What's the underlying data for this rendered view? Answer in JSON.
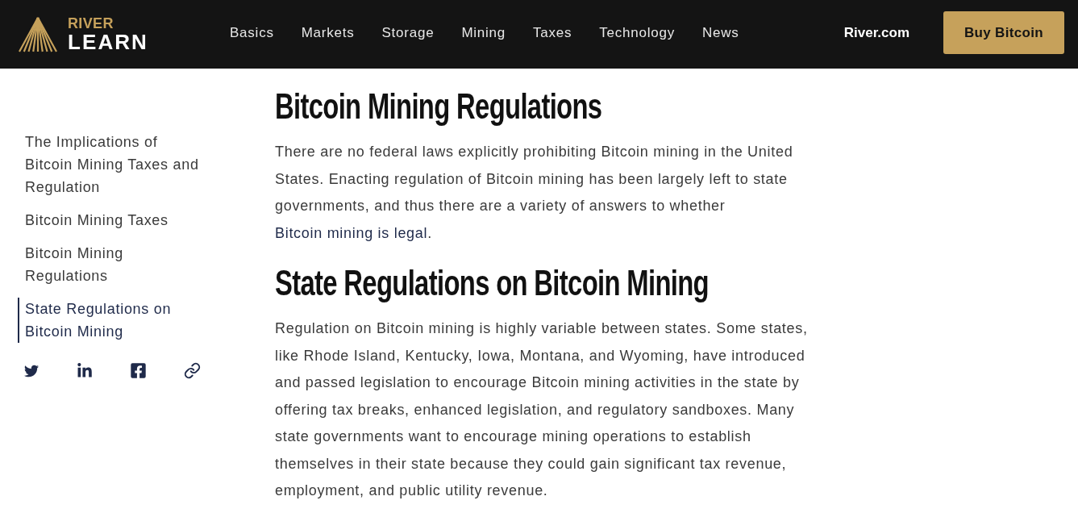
{
  "header": {
    "logo": {
      "top": "RIVER",
      "bottom": "LEARN"
    },
    "nav": [
      {
        "label": "Basics"
      },
      {
        "label": "Markets"
      },
      {
        "label": "Storage"
      },
      {
        "label": "Mining"
      },
      {
        "label": "Taxes"
      },
      {
        "label": "Technology"
      },
      {
        "label": "News"
      }
    ],
    "site_link": "River.com",
    "cta": "Buy Bitcoin"
  },
  "sidebar": {
    "toc": [
      {
        "label": "The Implications of Bitcoin Mining Taxes and Regulation",
        "selected": false
      },
      {
        "label": "Bitcoin Mining Taxes",
        "selected": false
      },
      {
        "label": "Bitcoin Mining Regulations",
        "selected": false
      },
      {
        "label": "State Regulations on Bitcoin Mining",
        "selected": true
      }
    ],
    "share": [
      {
        "kind": "twitter"
      },
      {
        "kind": "linkedin"
      },
      {
        "kind": "facebook"
      },
      {
        "kind": "link"
      }
    ]
  },
  "article": {
    "sections": [
      {
        "heading": "Bitcoin Mining Regulations",
        "paragraph": [
          {
            "kind": "text",
            "text": "There are no federal laws explicitly prohibiting Bitcoin mining in the United States. Enacting regulation of Bitcoin mining has been largely left to state governments, and thus there are a variety of answers to whether "
          },
          {
            "kind": "link",
            "text": "Bitcoin mining is legal"
          },
          {
            "kind": "text",
            "text": "."
          }
        ]
      },
      {
        "heading": "State Regulations on Bitcoin Mining",
        "paragraph": [
          {
            "kind": "text",
            "text": "Regulation on Bitcoin mining is highly variable between states. Some states, like Rhode Island, Kentucky, Iowa, Montana, and Wyoming, have introduced and passed legislation to encourage Bitcoin mining activities in the state by offering tax breaks, enhanced legislation, and regulatory sandboxes. Many state governments want to encourage mining operations to establish themselves in their state because they could gain significant tax revenue, employment, and public utility revenue."
          }
        ]
      }
    ]
  }
}
